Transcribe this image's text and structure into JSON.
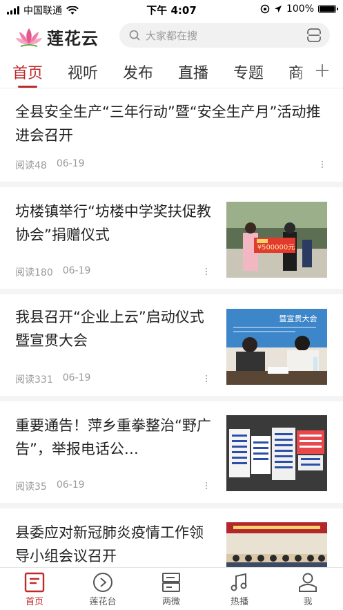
{
  "status_bar": {
    "carrier": "中国联通",
    "time": "下午 4:07",
    "battery": "100%",
    "battery_level": 1.0
  },
  "header": {
    "logo_text": "莲花云",
    "search_placeholder": "大家都在搜"
  },
  "tabs": [
    {
      "label": "首页",
      "active": true
    },
    {
      "label": "视听"
    },
    {
      "label": "发布"
    },
    {
      "label": "直播"
    },
    {
      "label": "专题"
    },
    {
      "label": "商"
    }
  ],
  "feed": [
    {
      "title": "全县安全生产“三年行动”暨“安全生产月”活动推进会召开",
      "reads": "阅读48",
      "date": "06-19",
      "has_image": false
    },
    {
      "title": "坊楼镇举行“坊楼中学奖扶促教协会”捐赠仪式",
      "reads": "阅读180",
      "date": "06-19",
      "has_image": true,
      "image_text": "¥500000元"
    },
    {
      "title": "我县召开“企业上云”启动仪式暨宣贯大会",
      "reads": "阅读331",
      "date": "06-19",
      "has_image": true,
      "image_text": "暨宣贯大会"
    },
    {
      "title": "重要通告！萍乡重拳整治“野广告”，举报电话公…",
      "reads": "阅读35",
      "date": "06-19",
      "has_image": true
    },
    {
      "title": "县委应对新冠肺炎疫情工作领导小组会议召开",
      "reads": "",
      "date": "",
      "has_image": true
    }
  ],
  "bottom_nav": [
    {
      "label": "首页",
      "icon": "home-icon",
      "active": true
    },
    {
      "label": "莲花台",
      "icon": "play-circle-icon"
    },
    {
      "label": "两微",
      "icon": "stack-icon"
    },
    {
      "label": "热播",
      "icon": "music-icon"
    },
    {
      "label": "我",
      "icon": "user-icon"
    }
  ],
  "colors": {
    "accent": "#c0282a",
    "text": "#222222",
    "muted": "#999999"
  }
}
